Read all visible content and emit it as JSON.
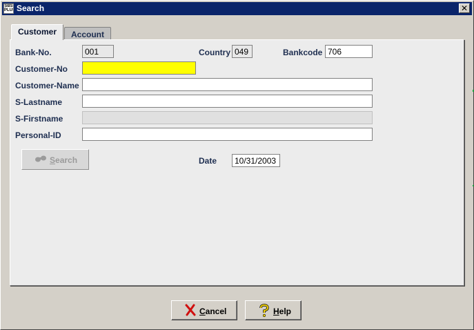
{
  "window": {
    "title": "Search",
    "app_icon_text": "SBS\nPLUS",
    "close_symbol": "✕"
  },
  "tabs": [
    {
      "label": "Customer",
      "active": true
    },
    {
      "label": "Account",
      "active": false
    }
  ],
  "form": {
    "bank_no_label": "Bank-No.",
    "bank_no_value": "001",
    "country_label": "Country",
    "country_value": "049",
    "bankcode_label": "Bankcode",
    "bankcode_value": "706",
    "customer_no_label": "Customer-No",
    "customer_no_value": "",
    "customer_name_label": "Customer-Name",
    "customer_name_value": "",
    "s_lastname_label": "S-Lastname",
    "s_lastname_value": "",
    "s_firstname_label": "S-Firstname",
    "s_firstname_value": "",
    "personal_id_label": "Personal-ID",
    "personal_id_value": "",
    "date_label": "Date",
    "date_value": "10/31/2003"
  },
  "buttons": {
    "search_first": "S",
    "search_rest": "earch",
    "search_icon": "binoculars-icon",
    "cancel_first": "C",
    "cancel_rest": "ancel",
    "cancel_icon": "red-x-icon",
    "help_first": "H",
    "help_rest": "elp",
    "help_icon": "question-mark-icon"
  },
  "colors": {
    "titlebar": "#0a246a",
    "highlight_field": "#ffff00",
    "cancel_icon": "#d01010",
    "help_icon": "#e8c800"
  }
}
